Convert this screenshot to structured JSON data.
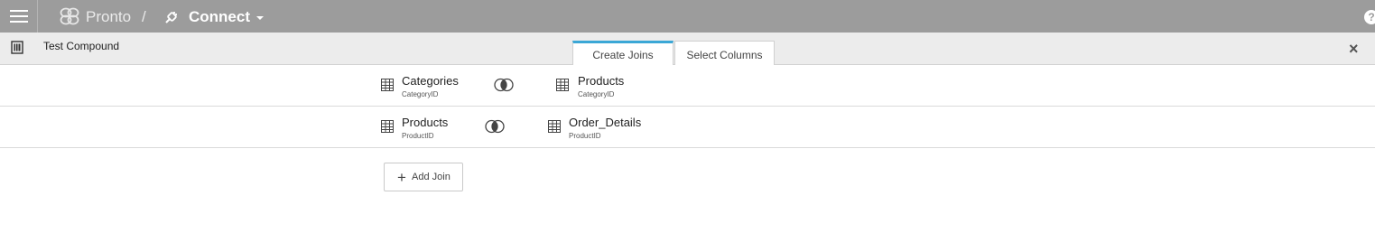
{
  "topbar": {
    "app_name": "Pronto",
    "separator": "/",
    "section": "Connect",
    "help": "?"
  },
  "subheader": {
    "title": "Test Compound",
    "tabs": [
      {
        "label": "Create Joins",
        "active": true
      },
      {
        "label": "Select Columns",
        "active": false
      }
    ],
    "close": "×"
  },
  "joins": [
    {
      "left": {
        "table": "Categories",
        "field": "CategoryID"
      },
      "type": "inner-join",
      "right": {
        "table": "Products",
        "field": "CategoryID"
      }
    },
    {
      "left": {
        "table": "Products",
        "field": "ProductID"
      },
      "type": "inner-join",
      "right": {
        "table": "Order_Details",
        "field": "ProductID"
      }
    }
  ],
  "add_join_label": "Add Join",
  "icons": {
    "menu": "hamburger-icon",
    "logo": "pronto-logo-icon",
    "connect": "connect-plug-icon",
    "table": "table-grid-icon",
    "join": "inner-join-venn-icon",
    "add": "plus-icon"
  },
  "colors": {
    "topbar": "#9c9c9c",
    "subheader": "#ececec",
    "active_tab_accent": "#3ba7d6"
  }
}
